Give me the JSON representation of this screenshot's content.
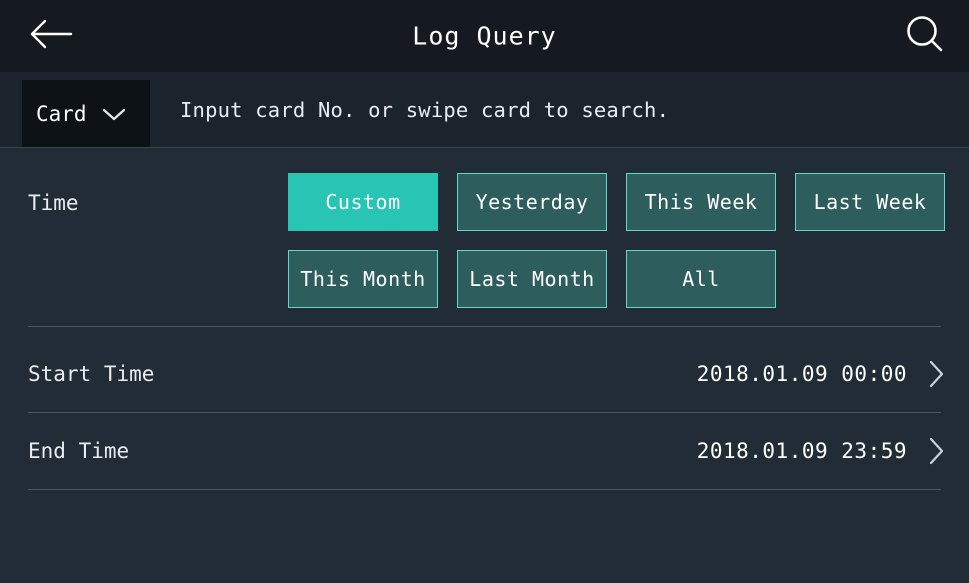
{
  "header": {
    "title": "Log Query",
    "back_icon": "arrow-left-icon",
    "search_icon": "search-icon"
  },
  "search": {
    "type_label": "Card",
    "type_chevron_icon": "chevron-down-icon",
    "placeholder": "Input card No. or swipe card to search."
  },
  "time_section": {
    "label": "Time",
    "buttons": [
      {
        "label": "Custom",
        "active": true
      },
      {
        "label": "Yesterday",
        "active": false
      },
      {
        "label": "This Week",
        "active": false
      },
      {
        "label": "Last Week",
        "active": false
      },
      {
        "label": "This Month",
        "active": false
      },
      {
        "label": "Last Month",
        "active": false
      },
      {
        "label": "All",
        "active": false
      }
    ]
  },
  "rows": [
    {
      "label": "Start Time",
      "value": "2018.01.09  00:00",
      "chevron_icon": "chevron-right-icon"
    },
    {
      "label": "End Time",
      "value": "2018.01.09  23:59",
      "chevron_icon": "chevron-right-icon"
    }
  ],
  "colors": {
    "background": "#222c36",
    "header_background": "#151a21",
    "search_background": "#1b232c",
    "accent": "#28c4b4",
    "button_border": "#5fd9c8",
    "button_fill": "#2d5d5c",
    "divider": "#4a5560",
    "text": "#ffffff"
  }
}
